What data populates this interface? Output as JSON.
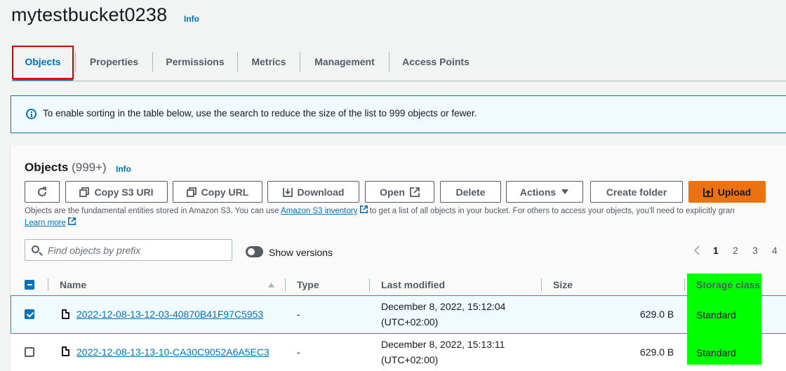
{
  "bucket": {
    "name": "mytestbucket0238",
    "info": "Info"
  },
  "tabs": [
    "Objects",
    "Properties",
    "Permissions",
    "Metrics",
    "Management",
    "Access Points"
  ],
  "alert": {
    "text": "To enable sorting in the table below, use the search to reduce the size of the list to 999 objects or fewer."
  },
  "objects": {
    "heading": "Objects",
    "count": "(999+)",
    "info": "Info",
    "buttons": {
      "copy_uri": "Copy S3 URI",
      "copy_url": "Copy URL",
      "download": "Download",
      "open": "Open",
      "delete": "Delete",
      "actions": "Actions",
      "create_folder": "Create folder",
      "upload": "Upload"
    },
    "desc_pre": "Objects are the fundamental entities stored in Amazon S3. You can use",
    "desc_link": "Amazon S3 inventory",
    "desc_post": "to get a list of all objects in your bucket. For others to access your objects, you'll need to explicitly gran",
    "learn_more": "Learn more",
    "search_placeholder": "Find objects by prefix",
    "show_versions": "Show versions",
    "pages": [
      "1",
      "2",
      "3",
      "4"
    ]
  },
  "table": {
    "headers": {
      "name": "Name",
      "type": "Type",
      "last_modified": "Last modified",
      "size": "Size",
      "storage_class": "Storage class"
    },
    "rows": [
      {
        "name": "2022-12-08-13-12-03-40870B41F97C5953",
        "type": "-",
        "date": "December 8, 2022, 15:12:04",
        "tz": "(UTC+02:00)",
        "size": "629.0 B",
        "storage": "Standard",
        "selected": true
      },
      {
        "name": "2022-12-08-13-13-10-CA30C9052A6A5EC3",
        "type": "-",
        "date": "December 8, 2022, 15:13:11",
        "tz": "(UTC+02:00)",
        "size": "629.0 B",
        "storage": "Standard",
        "selected": false
      }
    ]
  },
  "colors": {
    "accent": "#0073bb",
    "upload": "#ec7211",
    "highlight_green": "#00ff00",
    "red_box": "#d90000"
  }
}
